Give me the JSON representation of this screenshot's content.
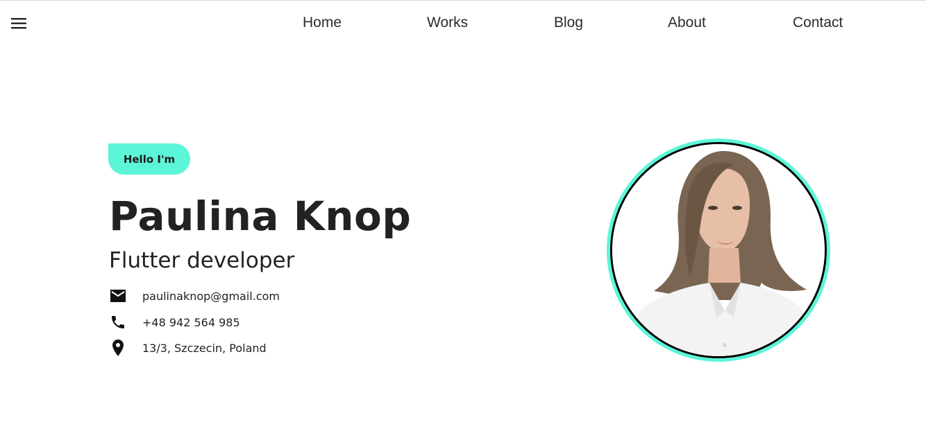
{
  "nav": {
    "menu_icon": "hamburger-menu-icon",
    "items": [
      {
        "label": "Home"
      },
      {
        "label": "Works"
      },
      {
        "label": "Blog"
      },
      {
        "label": "About"
      },
      {
        "label": "Contact"
      }
    ]
  },
  "hero": {
    "greeting": "Hello I'm",
    "name": "Paulina Knop",
    "role": "Flutter developer",
    "contacts": [
      {
        "icon": "mail-icon",
        "text": "paulinaknop@gmail.com"
      },
      {
        "icon": "phone-icon",
        "text": "+48 942 564 985"
      },
      {
        "icon": "location-pin-icon",
        "text": "13/3, Szczecin, Poland"
      }
    ]
  },
  "colors": {
    "accent": "#5cf5d8",
    "text": "#222222",
    "background": "#ffffff"
  }
}
